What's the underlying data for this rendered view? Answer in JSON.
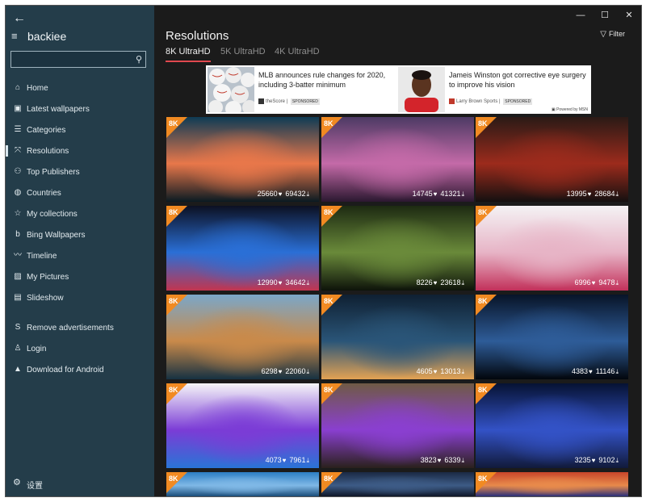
{
  "app": {
    "name": "backiee"
  },
  "search": {
    "placeholder": ""
  },
  "nav": [
    {
      "id": "home",
      "label": "Home",
      "icon": "home-icon",
      "glyph": "⌂"
    },
    {
      "id": "latest",
      "label": "Latest wallpapers",
      "icon": "image-icon",
      "glyph": "▣"
    },
    {
      "id": "categories",
      "label": "Categories",
      "icon": "list-icon",
      "glyph": "☰"
    },
    {
      "id": "resolutions",
      "label": "Resolutions",
      "icon": "resize-icon",
      "glyph": "⤧",
      "active": true
    },
    {
      "id": "publishers",
      "label": "Top Publishers",
      "icon": "people-icon",
      "glyph": "⚇"
    },
    {
      "id": "countries",
      "label": "Countries",
      "icon": "globe-icon",
      "glyph": "◍"
    },
    {
      "id": "collections",
      "label": "My collections",
      "icon": "star-icon",
      "glyph": "☆"
    },
    {
      "id": "bing",
      "label": "Bing Wallpapers",
      "icon": "bing-icon",
      "glyph": "b"
    },
    {
      "id": "timeline",
      "label": "Timeline",
      "icon": "timeline-icon",
      "glyph": "〰"
    },
    {
      "id": "pictures",
      "label": "My Pictures",
      "icon": "picture-icon",
      "glyph": "▨"
    },
    {
      "id": "slideshow",
      "label": "Slideshow",
      "icon": "slideshow-icon",
      "glyph": "▤"
    }
  ],
  "nav_secondary": [
    {
      "id": "remove-ads",
      "label": "Remove advertisements",
      "icon": "dollar-icon",
      "glyph": "S"
    },
    {
      "id": "login",
      "label": "Login",
      "icon": "user-icon",
      "glyph": "♙"
    },
    {
      "id": "android",
      "label": "Download for Android",
      "icon": "android-icon",
      "glyph": "▲"
    }
  ],
  "settings": {
    "label": "设置",
    "icon": "gear-icon"
  },
  "header": {
    "title": "Resolutions",
    "filter_label": "Filter"
  },
  "tabs": [
    {
      "label": "8K UltraHD",
      "active": true
    },
    {
      "label": "5K UltraHD",
      "active": false
    },
    {
      "label": "4K UltraHD",
      "active": false
    }
  ],
  "ad": {
    "items": [
      {
        "title": "MLB announces rule changes for 2020, including 3-batter minimum",
        "source": "theScore",
        "badge": "SPONSORED"
      },
      {
        "title": "Jameis Winston got corrective eye surgery to improve his vision",
        "source": "Larry Brown Sports",
        "badge": "SPONSORED"
      }
    ],
    "powered_by": "Powered by MSN"
  },
  "tiles": [
    {
      "badge": "8K",
      "likes": "25660",
      "downloads": "69432",
      "colors": [
        "#0e3b55",
        "#e8774a",
        "#0a1a22"
      ]
    },
    {
      "badge": "8K",
      "likes": "14745",
      "downloads": "41321",
      "colors": [
        "#4d3a64",
        "#c46aa8",
        "#2b1830"
      ]
    },
    {
      "badge": "8K",
      "likes": "13995",
      "downloads": "28684",
      "colors": [
        "#2a1a16",
        "#9c2b1c",
        "#141010"
      ]
    },
    {
      "badge": "8K",
      "likes": "12990",
      "downloads": "34642",
      "colors": [
        "#0c1022",
        "#2a6fd6",
        "#c2354f"
      ]
    },
    {
      "badge": "8K",
      "likes": "8226",
      "downloads": "23618",
      "colors": [
        "#1d2a12",
        "#6a8a3a",
        "#0d130a"
      ]
    },
    {
      "badge": "8K",
      "likes": "6996",
      "downloads": "9478",
      "colors": [
        "#f4f2f4",
        "#e7b4c6",
        "#c2305a"
      ]
    },
    {
      "badge": "8K",
      "likes": "6298",
      "downloads": "22060",
      "colors": [
        "#7aa7c9",
        "#c98a4a",
        "#163142"
      ]
    },
    {
      "badge": "8K",
      "likes": "4605",
      "downloads": "13013",
      "colors": [
        "#0f2032",
        "#2a5578",
        "#e3a253"
      ]
    },
    {
      "badge": "8K",
      "likes": "4383",
      "downloads": "11146",
      "colors": [
        "#081428",
        "#2e5c98",
        "#02060c"
      ]
    },
    {
      "badge": "8K",
      "likes": "4073",
      "downloads": "7961",
      "colors": [
        "#f6f6f8",
        "#7b3cd6",
        "#2a74d6"
      ]
    },
    {
      "badge": "8K",
      "likes": "3823",
      "downloads": "6339",
      "colors": [
        "#6f5a45",
        "#8a3fd0",
        "#2a211c"
      ]
    },
    {
      "badge": "8K",
      "likes": "3235",
      "downloads": "9102",
      "colors": [
        "#061233",
        "#3352c6",
        "#111a3a"
      ]
    },
    {
      "badge": "8K",
      "likes": "",
      "downloads": "",
      "colors": [
        "#2c7fc4",
        "#7fb8e6",
        "#1a4d7a"
      ]
    },
    {
      "badge": "8K",
      "likes": "",
      "downloads": "",
      "colors": [
        "#1b2a44",
        "#3d5b86",
        "#0f1728"
      ]
    },
    {
      "badge": "8K",
      "likes": "",
      "downloads": "",
      "colors": [
        "#c8462a",
        "#e88a4b",
        "#2a2f7a"
      ]
    }
  ],
  "colors": {
    "sidebar": "#243d4a",
    "accent": "#e0484f",
    "badge": "#f18a22",
    "background": "#1b1b1b"
  }
}
